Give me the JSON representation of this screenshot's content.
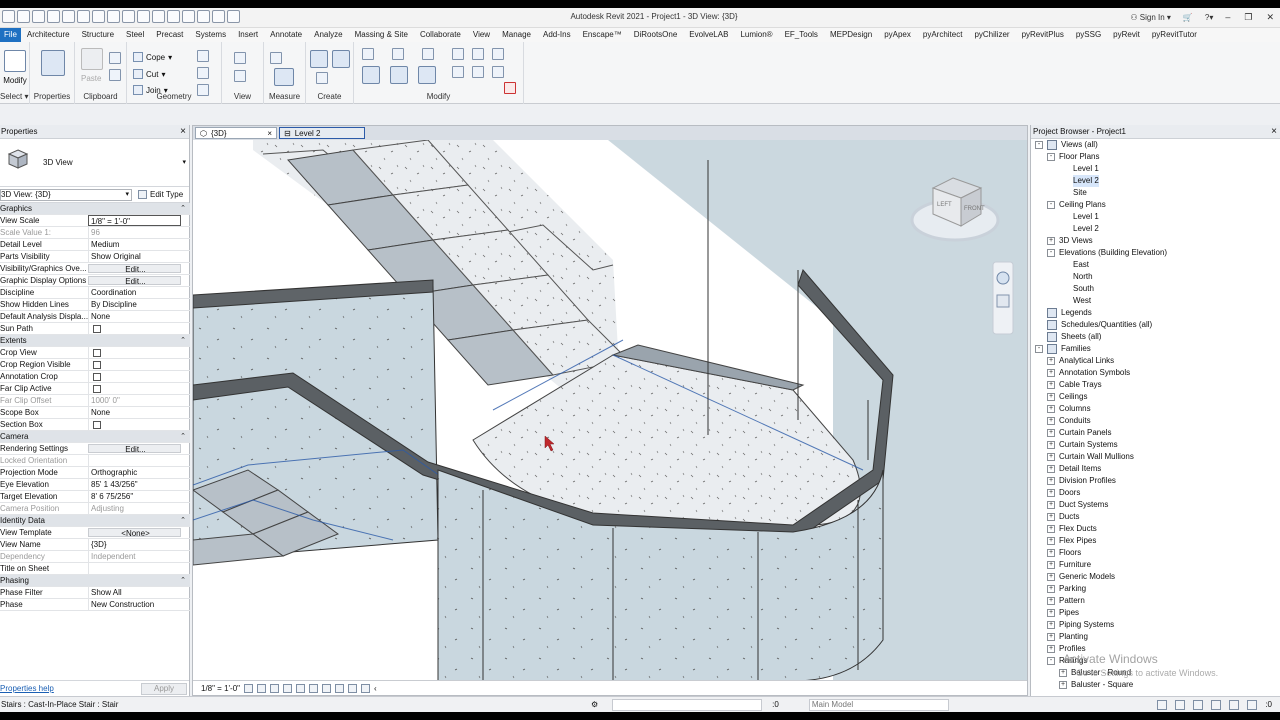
{
  "titlebar": {
    "title": "Autodesk Revit 2021 - Project1 - 3D View: {3D}",
    "sign_in": "Sign In"
  },
  "tabs": [
    "File",
    "Architecture",
    "Structure",
    "Steel",
    "Precast",
    "Systems",
    "Insert",
    "Annotate",
    "Analyze",
    "Massing & Site",
    "Collaborate",
    "View",
    "Manage",
    "Add-Ins",
    "Enscape™",
    "DiRootsOne",
    "EvolveLAB",
    "Lumion®",
    "EF_Tools",
    "MEPDesign",
    "pyApex",
    "pyArchitect",
    "pyChilizer",
    "pyRevitPlus",
    "pySSG",
    "pyRevit",
    "pyRevitTutor"
  ],
  "ribbon": {
    "modify": "Modify",
    "select": "Select",
    "properties": "Properties",
    "paste": "Paste",
    "clipboard": "Clipboard",
    "cope": "Cope",
    "cut": "Cut",
    "join": "Join",
    "geometry": "Geometry",
    "view": "View",
    "measure": "Measure",
    "create": "Create",
    "modify_group": "Modify"
  },
  "properties": {
    "header": "Properties",
    "type_name": "3D View",
    "instance_selector": "3D View: {3D}",
    "edit_type": "Edit Type",
    "rows": [
      {
        "k": "Graphics",
        "section": true
      },
      {
        "k": "View Scale",
        "v": "1/8\" = 1'-0\"",
        "input": true
      },
      {
        "k": "Scale Value    1:",
        "v": "96",
        "dim": true
      },
      {
        "k": "Detail Level",
        "v": "Medium"
      },
      {
        "k": "Parts Visibility",
        "v": "Show Original"
      },
      {
        "k": "Visibility/Graphics Ove...",
        "v": "Edit...",
        "btn": true
      },
      {
        "k": "Graphic Display Options",
        "v": "Edit...",
        "btn": true
      },
      {
        "k": "Discipline",
        "v": "Coordination"
      },
      {
        "k": "Show Hidden Lines",
        "v": "By Discipline"
      },
      {
        "k": "Default Analysis Displa...",
        "v": "None"
      },
      {
        "k": "Sun Path",
        "cb": true
      },
      {
        "k": "Extents",
        "section": true
      },
      {
        "k": "Crop View",
        "cb": true
      },
      {
        "k": "Crop Region Visible",
        "cb": true
      },
      {
        "k": "Annotation Crop",
        "cb": true
      },
      {
        "k": "Far Clip Active",
        "cb": true
      },
      {
        "k": "Far Clip Offset",
        "v": "1000'  0\"",
        "dim": true
      },
      {
        "k": "Scope Box",
        "v": "None"
      },
      {
        "k": "Section Box",
        "cb": true
      },
      {
        "k": "Camera",
        "section": true
      },
      {
        "k": "Rendering Settings",
        "v": "Edit...",
        "btn": true
      },
      {
        "k": "Locked Orientation",
        "v": "",
        "dim": true
      },
      {
        "k": "Projection Mode",
        "v": "Orthographic"
      },
      {
        "k": "Eye Elevation",
        "v": "85'  1 43/256\""
      },
      {
        "k": "Target Elevation",
        "v": "8'  6 75/256\""
      },
      {
        "k": "Camera Position",
        "v": "Adjusting",
        "dim": true
      },
      {
        "k": "Identity Data",
        "section": true
      },
      {
        "k": "View Template",
        "v": "<None>",
        "btn": true
      },
      {
        "k": "View Name",
        "v": "{3D}"
      },
      {
        "k": "Dependency",
        "v": "Independent",
        "dim": true
      },
      {
        "k": "Title on Sheet",
        "v": ""
      },
      {
        "k": "Phasing",
        "section": true
      },
      {
        "k": "Phase Filter",
        "v": "Show All"
      },
      {
        "k": "Phase",
        "v": "New Construction"
      }
    ],
    "help": "Properties help",
    "apply": "Apply"
  },
  "view": {
    "tabs": [
      {
        "label": "{3D}",
        "active": true
      },
      {
        "label": "Level 2",
        "active": false
      }
    ],
    "scale": "1/8\" = 1'-0\"",
    "viewcube_front": "FRONT",
    "viewcube_left": "LEFT"
  },
  "browser": {
    "header": "Project Browser - Project1",
    "nodes": [
      {
        "label": "Views (all)",
        "level": 0,
        "toggle": "-",
        "icon": true
      },
      {
        "label": "Floor Plans",
        "level": 1,
        "toggle": "-"
      },
      {
        "label": "Level 1",
        "level": 2
      },
      {
        "label": "Level 2",
        "level": 2,
        "selected": true
      },
      {
        "label": "Site",
        "level": 2
      },
      {
        "label": "Ceiling Plans",
        "level": 1,
        "toggle": "-"
      },
      {
        "label": "Level 1",
        "level": 2
      },
      {
        "label": "Level 2",
        "level": 2
      },
      {
        "label": "3D Views",
        "level": 1,
        "toggle": "+"
      },
      {
        "label": "Elevations (Building Elevation)",
        "level": 1,
        "toggle": "-"
      },
      {
        "label": "East",
        "level": 2
      },
      {
        "label": "North",
        "level": 2
      },
      {
        "label": "South",
        "level": 2
      },
      {
        "label": "West",
        "level": 2
      },
      {
        "label": "Legends",
        "level": 0,
        "icon": true
      },
      {
        "label": "Schedules/Quantities (all)",
        "level": 0,
        "icon": true
      },
      {
        "label": "Sheets (all)",
        "level": 0,
        "icon": true
      },
      {
        "label": "Families",
        "level": 0,
        "toggle": "-",
        "icon": true
      },
      {
        "label": "Analytical Links",
        "level": 1,
        "toggle": "+"
      },
      {
        "label": "Annotation Symbols",
        "level": 1,
        "toggle": "+"
      },
      {
        "label": "Cable Trays",
        "level": 1,
        "toggle": "+"
      },
      {
        "label": "Ceilings",
        "level": 1,
        "toggle": "+"
      },
      {
        "label": "Columns",
        "level": 1,
        "toggle": "+"
      },
      {
        "label": "Conduits",
        "level": 1,
        "toggle": "+"
      },
      {
        "label": "Curtain Panels",
        "level": 1,
        "toggle": "+"
      },
      {
        "label": "Curtain Systems",
        "level": 1,
        "toggle": "+"
      },
      {
        "label": "Curtain Wall Mullions",
        "level": 1,
        "toggle": "+"
      },
      {
        "label": "Detail Items",
        "level": 1,
        "toggle": "+"
      },
      {
        "label": "Division Profiles",
        "level": 1,
        "toggle": "+"
      },
      {
        "label": "Doors",
        "level": 1,
        "toggle": "+"
      },
      {
        "label": "Duct Systems",
        "level": 1,
        "toggle": "+"
      },
      {
        "label": "Ducts",
        "level": 1,
        "toggle": "+"
      },
      {
        "label": "Flex Ducts",
        "level": 1,
        "toggle": "+"
      },
      {
        "label": "Flex Pipes",
        "level": 1,
        "toggle": "+"
      },
      {
        "label": "Floors",
        "level": 1,
        "toggle": "+"
      },
      {
        "label": "Furniture",
        "level": 1,
        "toggle": "+"
      },
      {
        "label": "Generic Models",
        "level": 1,
        "toggle": "+"
      },
      {
        "label": "Parking",
        "level": 1,
        "toggle": "+"
      },
      {
        "label": "Pattern",
        "level": 1,
        "toggle": "+"
      },
      {
        "label": "Pipes",
        "level": 1,
        "toggle": "+"
      },
      {
        "label": "Piping Systems",
        "level": 1,
        "toggle": "+"
      },
      {
        "label": "Planting",
        "level": 1,
        "toggle": "+"
      },
      {
        "label": "Profiles",
        "level": 1,
        "toggle": "+"
      },
      {
        "label": "Railings",
        "level": 1,
        "toggle": "-"
      },
      {
        "label": "Baluster - Round",
        "level": 2,
        "toggle": "+"
      },
      {
        "label": "Baluster - Square",
        "level": 2,
        "toggle": "+"
      }
    ],
    "watermark_title": "Activate Windows",
    "watermark_sub": "Go to Settings to activate Windows."
  },
  "status": {
    "message": "Stairs : Cast-In-Place Stair : Stair",
    "zero": ":0",
    "model": "Main Model",
    "filter_count": ":0"
  }
}
